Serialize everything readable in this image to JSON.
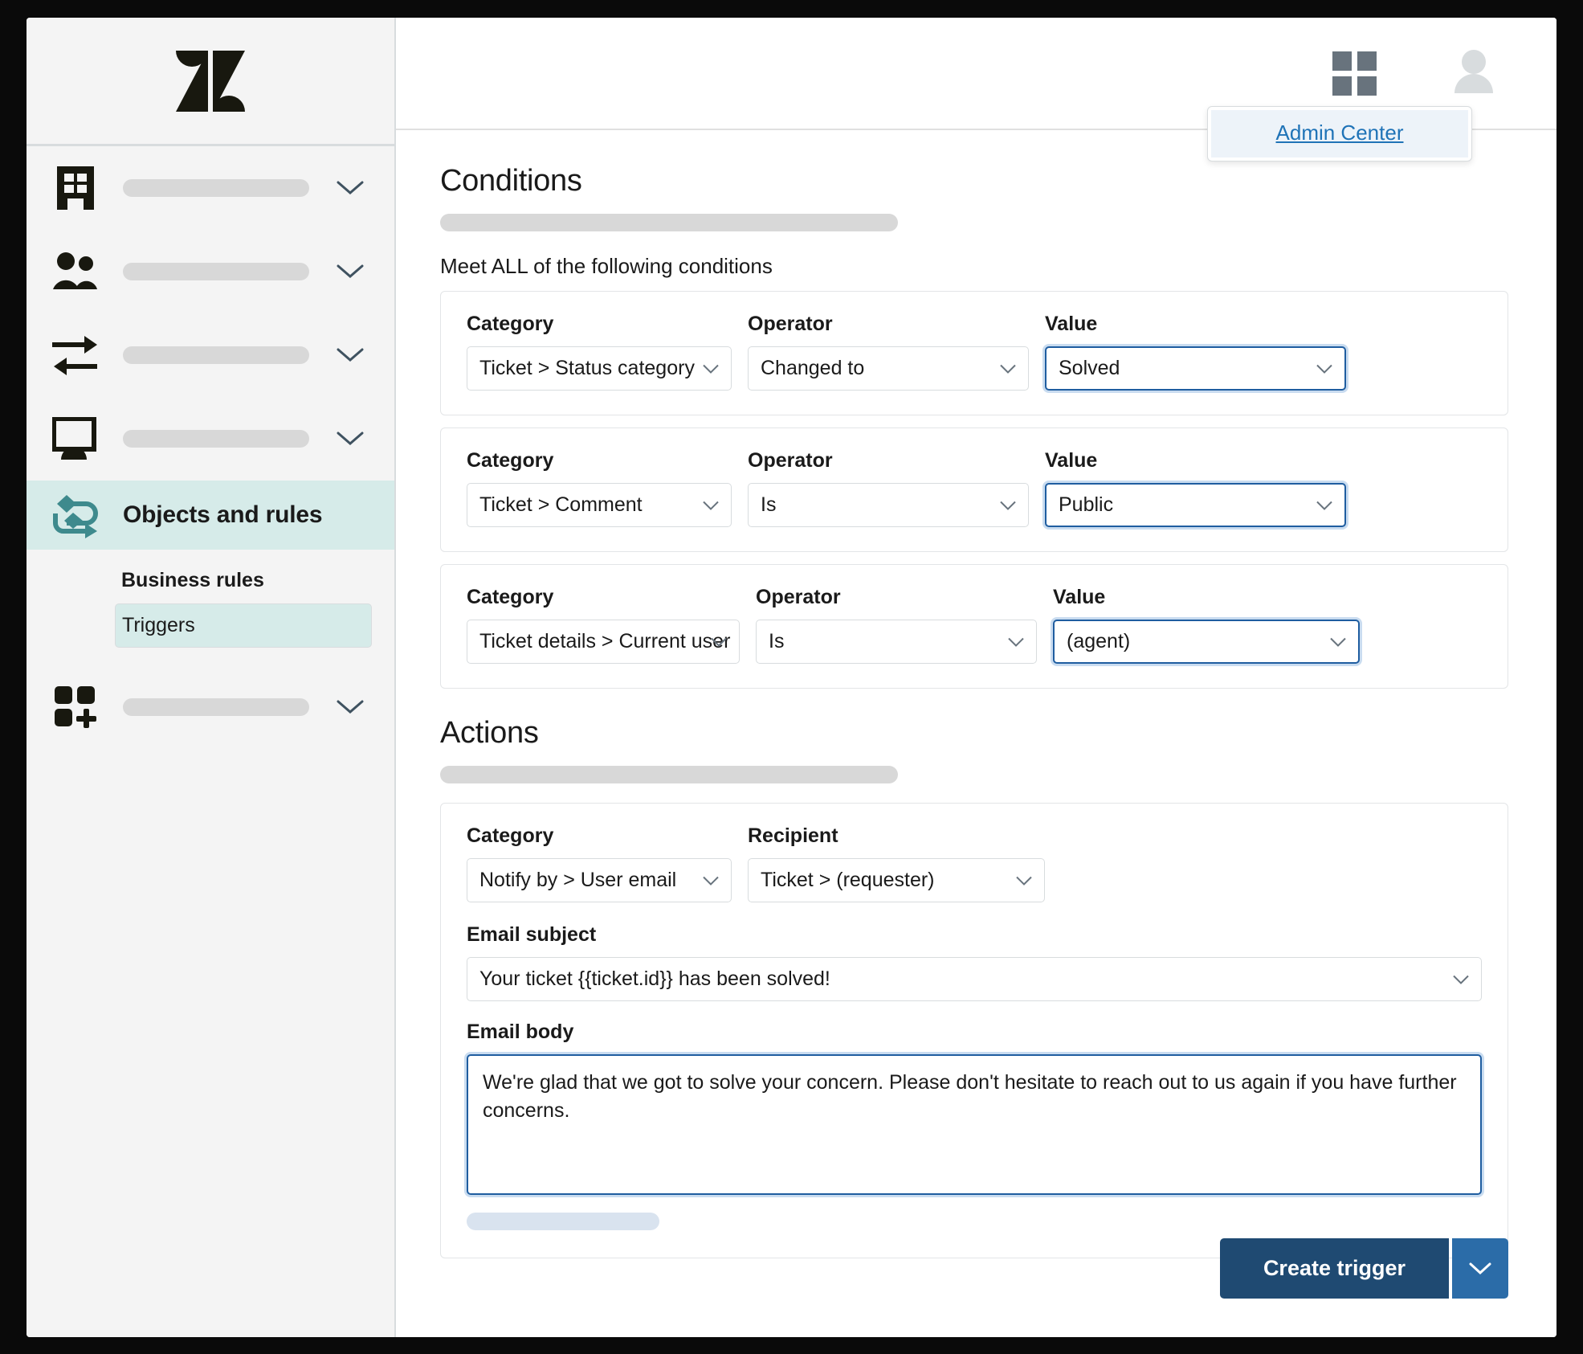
{
  "sidebar": {
    "logo": "zendesk-logo",
    "nav_items": [
      {
        "icon": "building-icon",
        "label": "",
        "placeholder": true
      },
      {
        "icon": "people-icon",
        "label": "",
        "placeholder": true
      },
      {
        "icon": "transfer-arrows-icon",
        "label": "",
        "placeholder": true
      },
      {
        "icon": "monitor-icon",
        "label": "",
        "placeholder": true
      }
    ],
    "active_item": {
      "icon": "objects-rules-icon",
      "label": "Objects and rules"
    },
    "subnav": {
      "title": "Business rules",
      "items": [
        {
          "label": "Triggers",
          "selected": true
        }
      ]
    },
    "bottom_item": {
      "icon": "apps-plus-icon",
      "label": "",
      "placeholder": true
    }
  },
  "topbar": {
    "grid_icon": "grid-apps-icon",
    "avatar_icon": "user-avatar-icon",
    "dropdown": {
      "link_label": "Admin Center"
    }
  },
  "conditions": {
    "heading": "Conditions",
    "subtitle": "Meet ALL of the following conditions",
    "labels": {
      "category": "Category",
      "operator": "Operator",
      "value": "Value"
    },
    "rows": [
      {
        "category": "Ticket > Status category",
        "operator": "Changed to",
        "value": "Solved",
        "value_focused": true
      },
      {
        "category": "Ticket > Comment",
        "operator": "Is",
        "value": "Public",
        "value_focused": true
      },
      {
        "category": "Ticket details > Current user",
        "operator": "Is",
        "value": "(agent)",
        "value_focused": true
      }
    ]
  },
  "actions": {
    "heading": "Actions",
    "labels": {
      "category": "Category",
      "recipient": "Recipient",
      "email_subject": "Email subject",
      "email_body": "Email body"
    },
    "category": "Notify by > User email",
    "recipient": "Ticket > (requester)",
    "email_subject": "Your ticket {{ticket.id}} has been solved!",
    "email_body": "We're glad that we got to solve your concern. Please don't hesitate to reach out to us again if you have further concerns."
  },
  "footer": {
    "primary_button": "Create trigger",
    "split_icon": "chevron-down-icon"
  },
  "colors": {
    "accent_teal": "#d6ebe9",
    "link_blue": "#1f73b7",
    "focus_blue": "#1f5da0",
    "button_navy": "#1f4a72",
    "button_blue": "#2b6ca8",
    "placeholder_gray": "#d8d8d8"
  }
}
